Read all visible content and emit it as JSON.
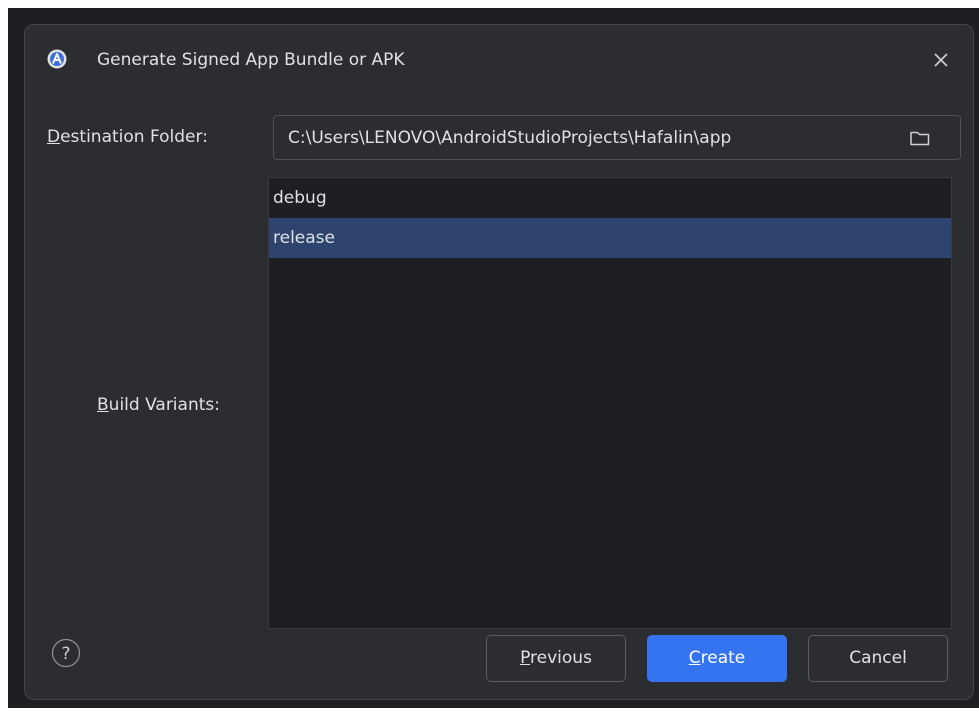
{
  "dialog": {
    "title": "Generate Signed App Bundle or APK",
    "app_icon": "android-studio-icon",
    "close_icon": "close-icon"
  },
  "destination": {
    "label_mnemonic": "D",
    "label_rest": "estination Folder:",
    "path": "C:\\Users\\LENOVO\\AndroidStudioProjects\\Hafalin\\app",
    "folder_icon": "folder-icon"
  },
  "build_variants": {
    "label_mnemonic": "B",
    "label_rest": "uild Variants:",
    "items": [
      {
        "label": "debug",
        "selected": false
      },
      {
        "label": "release",
        "selected": true
      }
    ]
  },
  "footer": {
    "help_icon": "help-icon",
    "help_glyph": "?",
    "previous_mnemonic": "P",
    "previous_rest": "revious",
    "create_mnemonic": "C",
    "create_rest": "reate",
    "cancel_label": "Cancel"
  },
  "colors": {
    "dialog_bg": "#2b2d30",
    "list_bg": "#1e1f22",
    "selection": "#2e436e",
    "primary_button": "#3574f0",
    "text": "#dfe1e5"
  }
}
